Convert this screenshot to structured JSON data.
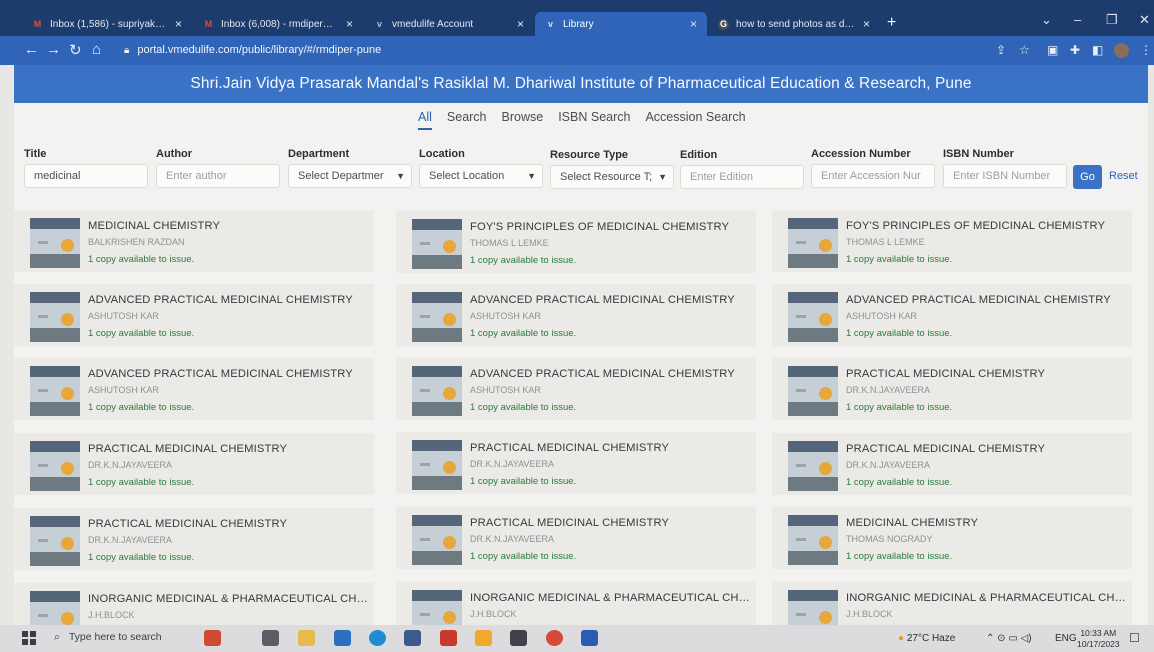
{
  "browser": {
    "tabs": [
      {
        "title": "Inbox (1,586) - supriyakuber@g...",
        "favicon": "gmail-icon",
        "active": false
      },
      {
        "title": "Inbox (6,008) - rmdiper@gmail...",
        "favicon": "gmail-icon",
        "active": false
      },
      {
        "title": "vmedulife Account",
        "favicon": "vmedulife-icon",
        "active": false
      },
      {
        "title": "Library",
        "favicon": "vmedulife-icon",
        "active": true
      },
      {
        "title": "how to send photos as docume...",
        "favicon": "google-icon",
        "active": false
      }
    ],
    "url": "portal.vmedulife.com/public/library/#/rmdiper-pune"
  },
  "page": {
    "institute_name": "Shri.Jain Vidya Prasarak Mandal's Rasiklal M. Dhariwal Institute of Pharmaceutical Education & Research, Pune",
    "nav_tabs": [
      {
        "label": "All",
        "active": true
      },
      {
        "label": "Search",
        "active": false
      },
      {
        "label": "Browse",
        "active": false
      },
      {
        "label": "ISBN Search",
        "active": false
      },
      {
        "label": "Accession Search",
        "active": false
      }
    ]
  },
  "filters": {
    "title": {
      "label": "Title",
      "value": "medicinal"
    },
    "author": {
      "label": "Author",
      "placeholder": "Enter author"
    },
    "department": {
      "label": "Department",
      "selected": "Select Departmer"
    },
    "location": {
      "label": "Location",
      "selected": "Select Location"
    },
    "resource_type": {
      "label": "Resource Type",
      "selected": "Select Resource T;"
    },
    "edition": {
      "label": "Edition",
      "placeholder": "Enter Edition"
    },
    "accession_number": {
      "label": "Accession Number",
      "placeholder": "Enter Accession Nur"
    },
    "isbn_number": {
      "label": "ISBN Number",
      "placeholder": "Enter ISBN Number"
    },
    "go_label": "Go",
    "reset_label": "Reset"
  },
  "books": [
    {
      "title": "MEDICINAL CHEMISTRY",
      "author": "BALKRISHEN RAZDAN",
      "availability": "1 copy available to issue."
    },
    {
      "title": "FOY'S PRINCIPLES OF MEDICINAL CHEMISTRY",
      "author": "THOMAS L LEMKE",
      "availability": "1 copy available to issue."
    },
    {
      "title": "FOY'S PRINCIPLES OF MEDICINAL CHEMISTRY",
      "author": "THOMAS L LEMKE",
      "availability": "1 copy available to issue."
    },
    {
      "title": "ADVANCED PRACTICAL MEDICINAL CHEMISTRY",
      "author": "ASHUTOSH KAR",
      "availability": "1 copy available to issue."
    },
    {
      "title": "ADVANCED PRACTICAL MEDICINAL CHEMISTRY",
      "author": "ASHUTOSH KAR",
      "availability": "1 copy available to issue."
    },
    {
      "title": "ADVANCED PRACTICAL MEDICINAL CHEMISTRY",
      "author": "ASHUTOSH KAR",
      "availability": "1 copy available to issue."
    },
    {
      "title": "ADVANCED PRACTICAL MEDICINAL CHEMISTRY",
      "author": "ASHUTOSH KAR",
      "availability": "1 copy available to issue."
    },
    {
      "title": "ADVANCED PRACTICAL MEDICINAL CHEMISTRY",
      "author": "ASHUTOSH KAR",
      "availability": "1 copy available to issue."
    },
    {
      "title": "PRACTICAL MEDICINAL CHEMISTRY",
      "author": "DR.K.N.JAYAVEERA",
      "availability": "1 copy available to issue."
    },
    {
      "title": "PRACTICAL MEDICINAL CHEMISTRY",
      "author": "DR.K.N.JAYAVEERA",
      "availability": "1 copy available to issue."
    },
    {
      "title": "PRACTICAL MEDICINAL CHEMISTRY",
      "author": "DR.K.N.JAYAVEERA",
      "availability": "1 copy available to issue."
    },
    {
      "title": "PRACTICAL MEDICINAL CHEMISTRY",
      "author": "DR.K.N.JAYAVEERA",
      "availability": "1 copy available to issue."
    },
    {
      "title": "PRACTICAL MEDICINAL CHEMISTRY",
      "author": "DR.K.N.JAYAVEERA",
      "availability": "1 copy available to issue."
    },
    {
      "title": "PRACTICAL MEDICINAL CHEMISTRY",
      "author": "DR.K.N.JAYAVEERA",
      "availability": "1 copy available to issue."
    },
    {
      "title": "MEDICINAL CHEMISTRY",
      "author": "THOMAS NOGRADY",
      "availability": "1 copy available to issue."
    },
    {
      "title": "INORGANIC MEDICINAL & PHARMACEUTICAL CHE...",
      "author": "J.H.BLOCK",
      "availability": ""
    },
    {
      "title": "INORGANIC MEDICINAL & PHARMACEUTICAL CHE...",
      "author": "J.H.BLOCK",
      "availability": ""
    },
    {
      "title": "INORGANIC MEDICINAL & PHARMACEUTICAL CHE...",
      "author": "J.H.BLOCK",
      "availability": ""
    }
  ],
  "taskbar": {
    "search_placeholder": "Type here to search",
    "weather": "27°C  Haze",
    "language": "ENG",
    "time": "10:33 AM",
    "date": "10/17/2023"
  },
  "colors": {
    "brand_blue": "#3a73c6",
    "available_green": "#2b7b3b"
  }
}
